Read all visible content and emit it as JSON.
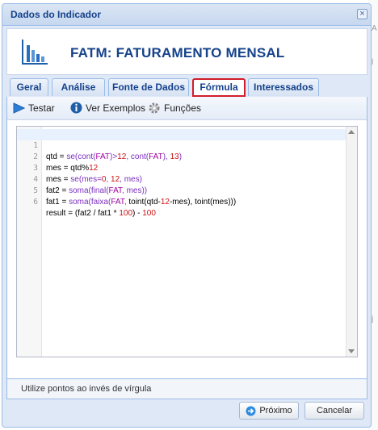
{
  "dialog": {
    "title": "Dados do Indicador",
    "header_title": "FATM: FATURAMENTO MENSAL"
  },
  "tabs": [
    {
      "label": "Geral"
    },
    {
      "label": "Análise"
    },
    {
      "label": "Fonte de Dados"
    },
    {
      "label": "Fórmula",
      "active": true
    },
    {
      "label": "Interessados"
    }
  ],
  "toolbar": {
    "test_label": "Testar",
    "examples_label": "Ver Exemplos",
    "functions_label": "Funções"
  },
  "editor": {
    "line_numbers": [
      "1",
      "2",
      "3",
      "4",
      "5",
      "6"
    ],
    "lines": [
      "qtd = se(cont(FAT)>12, cont(FAT), 13)",
      "mes = qtd%12",
      "mes = se(mes=0, 12, mes)",
      "fat2 = soma(final(FAT, mes))",
      "fat1 = soma(faixa(FAT, toint(qtd-12-mes), toint(mes)))",
      "result = (fat2 / fat1 * 100) - 100"
    ]
  },
  "hint": "Utilize pontos ao invés de vírgula",
  "footer": {
    "next_label": "Próximo",
    "cancel_label": "Cancelar"
  },
  "colors": {
    "title_blue": "#15428b",
    "active_tab_outline": "#d11d2a",
    "panel_border": "#99bbe8"
  },
  "icons": {
    "close": "close-icon",
    "logo": "bar-chart-icon",
    "test": "play-icon",
    "examples": "info-icon",
    "functions": "gear-icon",
    "next": "arrow-right-icon"
  }
}
